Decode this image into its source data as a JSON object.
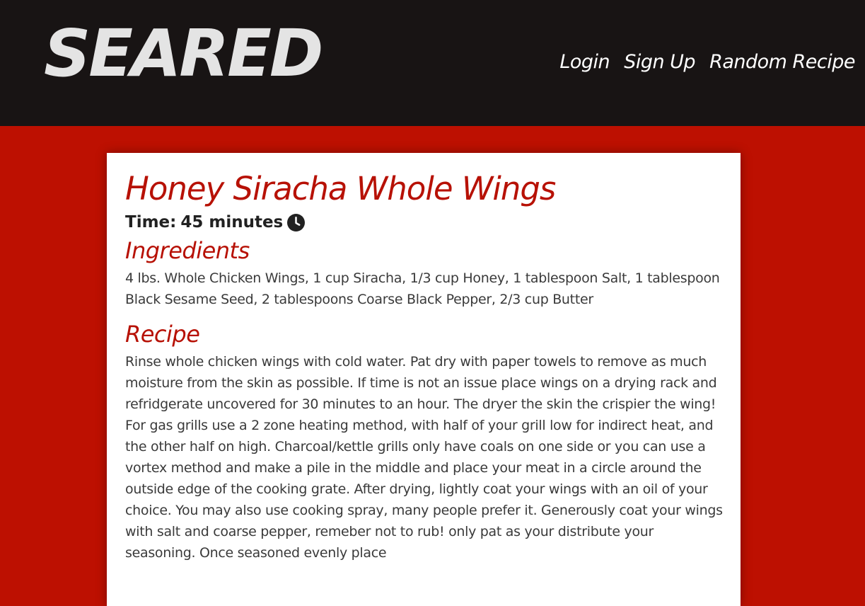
{
  "header": {
    "logo": "SEARED",
    "nav": [
      {
        "label": "Login"
      },
      {
        "label": "Sign Up"
      },
      {
        "label": "Random Recipe"
      }
    ]
  },
  "recipe": {
    "title": "Honey Siracha Whole Wings",
    "time_label": "Time:",
    "time_value": "45 minutes",
    "time_icon": "clock-icon",
    "ingredients_heading": "Ingredients",
    "ingredients": "4 lbs. Whole Chicken Wings, 1 cup Siracha, 1/3 cup Honey, 1 tablespoon Salt, 1 tablespoon Black Sesame Seed, 2 tablespoons Coarse Black Pepper, 2/3 cup Butter",
    "recipe_heading": "Recipe",
    "instructions": "Rinse whole chicken wings with cold water. Pat dry with paper towels to remove as much moisture from the skin as possible. If time is not an issue place wings on a drying rack and refridgerate uncovered for 30 minutes to an hour. The dryer the skin the crispier the wing! For gas grills use a 2 zone heating method, with half of your grill low for indirect heat, and the other half on high. Charcoal/kettle grills only have coals on one side or you can use a vortex method and make a pile in the middle and place your meat in a circle around the outside edge of the cooking grate. After drying, lightly coat your wings with an oil of your choice. You may also use cooking spray, many people prefer it. Generously coat your wings with salt and coarse pepper, remeber not to rub! only pat as your distribute your seasoning. Once seasoned evenly place"
  },
  "colors": {
    "header_bg": "#181414",
    "page_bg": "#bd1001",
    "accent": "#b71105",
    "logo": "#e4e4e4"
  }
}
